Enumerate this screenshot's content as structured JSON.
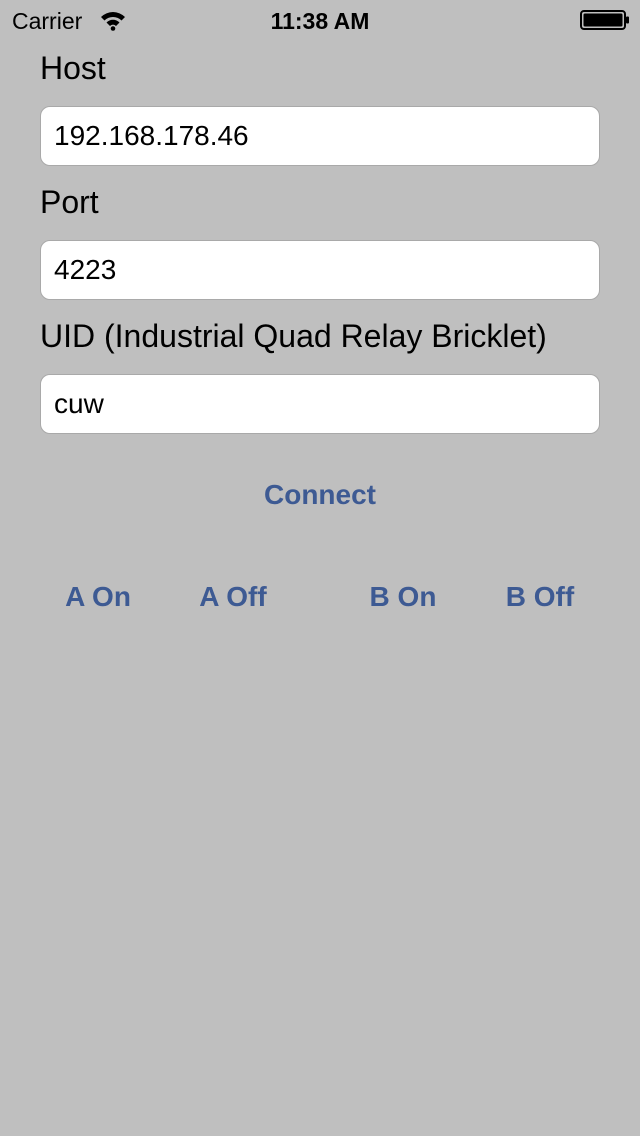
{
  "status_bar": {
    "carrier": "Carrier",
    "time": "11:38 AM"
  },
  "form": {
    "host_label": "Host",
    "host_value": "192.168.178.46",
    "port_label": "Port",
    "port_value": "4223",
    "uid_label": "UID (Industrial Quad Relay Bricklet)",
    "uid_value": "cuw"
  },
  "actions": {
    "connect_label": "Connect",
    "relay_buttons": [
      "A On",
      "A Off",
      "B On",
      "B Off"
    ]
  },
  "colors": {
    "background": "#bfbfbf",
    "button_text": "#3d5a93",
    "field_background": "#ffffff"
  }
}
